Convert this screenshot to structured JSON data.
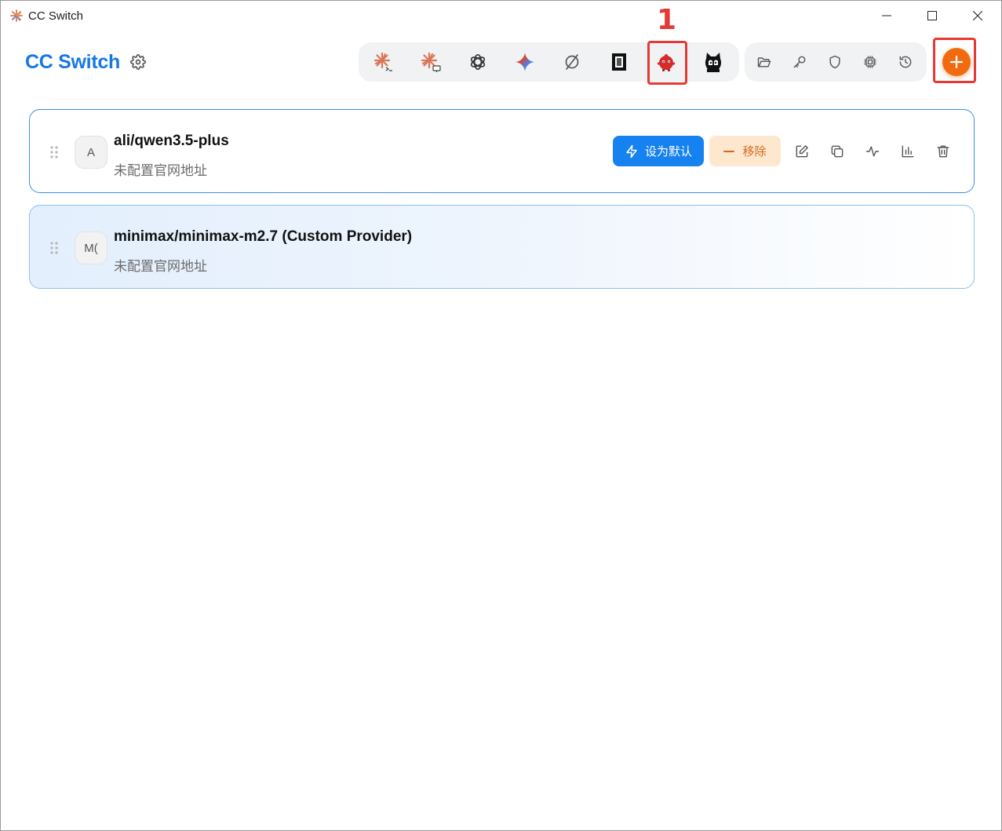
{
  "window": {
    "title": "CC Switch",
    "app_icon": "sunburst-logo-icon",
    "controls": [
      "minimize-icon",
      "maximize-icon",
      "close-icon"
    ]
  },
  "header": {
    "brand": "CC Switch",
    "settings_icon": "gear-icon",
    "app_switcher": [
      {
        "name": "claude-code-icon",
        "color": "#d97757"
      },
      {
        "name": "claude-desktop-icon",
        "color": "#d97757"
      },
      {
        "name": "openai-codex-icon",
        "color": "#333333"
      },
      {
        "name": "gemini-icon",
        "color": "#4285f4"
      },
      {
        "name": "opencode-icon",
        "color": "#555555"
      },
      {
        "name": "terminal-app-icon",
        "color": "#111111"
      },
      {
        "name": "red-mascot-app-icon",
        "color": "#d62b2b",
        "highlighted": true
      },
      {
        "name": "cat-mascot-app-icon",
        "color": "#111111"
      }
    ],
    "tools": [
      "folder-icon",
      "key-icon",
      "shield-icon",
      "chip-icon",
      "history-icon"
    ],
    "add_button_icon": "plus-icon",
    "annotation": "1"
  },
  "providers": [
    {
      "avatar": "A",
      "name": "ali/qwen3.5-plus",
      "url_status": "未配置官网地址",
      "set_default_label": "设为默认",
      "remove_label": "移除",
      "active": false
    },
    {
      "avatar": "M(",
      "name": "minimax/minimax-m2.7 (Custom Provider)",
      "url_status": "未配置官网地址",
      "active": true
    }
  ],
  "colors": {
    "brand": "#1677e6",
    "primary_button": "#1682f0",
    "remove_bg": "#fde7cf",
    "remove_text": "#d2691e",
    "add_button": "#f26a0f",
    "annotation": "#e53935"
  }
}
